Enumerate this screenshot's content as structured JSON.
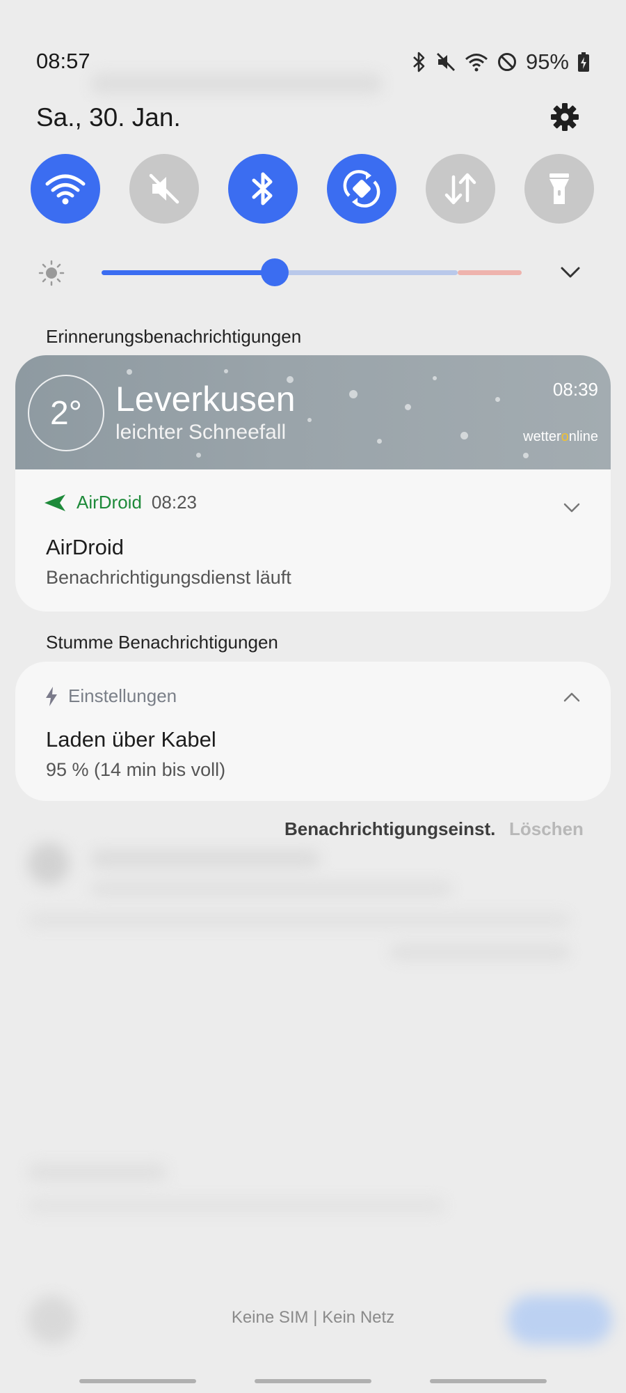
{
  "status_bar": {
    "time": "08:57",
    "battery_percent": "95%",
    "icons": [
      "bluetooth-icon",
      "mute-icon",
      "wifi-icon",
      "do-not-disturb-icon",
      "battery-charging-icon"
    ]
  },
  "header": {
    "date": "Sa., 30. Jan.",
    "settings_icon": "gear-icon"
  },
  "quick_toggles": [
    {
      "name": "wifi",
      "icon": "wifi-icon",
      "active": true
    },
    {
      "name": "sound",
      "icon": "mute-icon",
      "active": false
    },
    {
      "name": "bluetooth",
      "icon": "bluetooth-icon",
      "active": true
    },
    {
      "name": "auto-rotate",
      "icon": "rotate-icon",
      "active": true
    },
    {
      "name": "mobile-data",
      "icon": "data-transfer-icon",
      "active": false
    },
    {
      "name": "flashlight",
      "icon": "flashlight-icon",
      "active": false
    }
  ],
  "brightness": {
    "level": 0.41
  },
  "sections": {
    "reminders_label": "Erinnerungsbenachrichtigungen",
    "silent_label": "Stumme Benachrichtigungen"
  },
  "weather": {
    "temperature": "2°",
    "city": "Leverkusen",
    "condition": "leichter Schneefall",
    "time": "08:39",
    "provider_prefix": "wetter",
    "provider_mid": "o",
    "provider_suffix": "nline"
  },
  "airdroid": {
    "app": "AirDroid",
    "time": "08:23",
    "title": "AirDroid",
    "text": "Benachrichtigungsdienst läuft"
  },
  "charging": {
    "app": "Einstellungen",
    "title": "Laden über Kabel",
    "text": "95 % (14 min bis voll)"
  },
  "actions": {
    "settings_label": "Benachrichtigungseinst.",
    "clear_label": "Löschen"
  },
  "footer": {
    "network_status": "Keine SIM | Kein Netz"
  },
  "colors": {
    "accent": "#3b6df1",
    "inactive_toggle": "#c8c8c8",
    "airdroid_green": "#1e8a3a"
  }
}
